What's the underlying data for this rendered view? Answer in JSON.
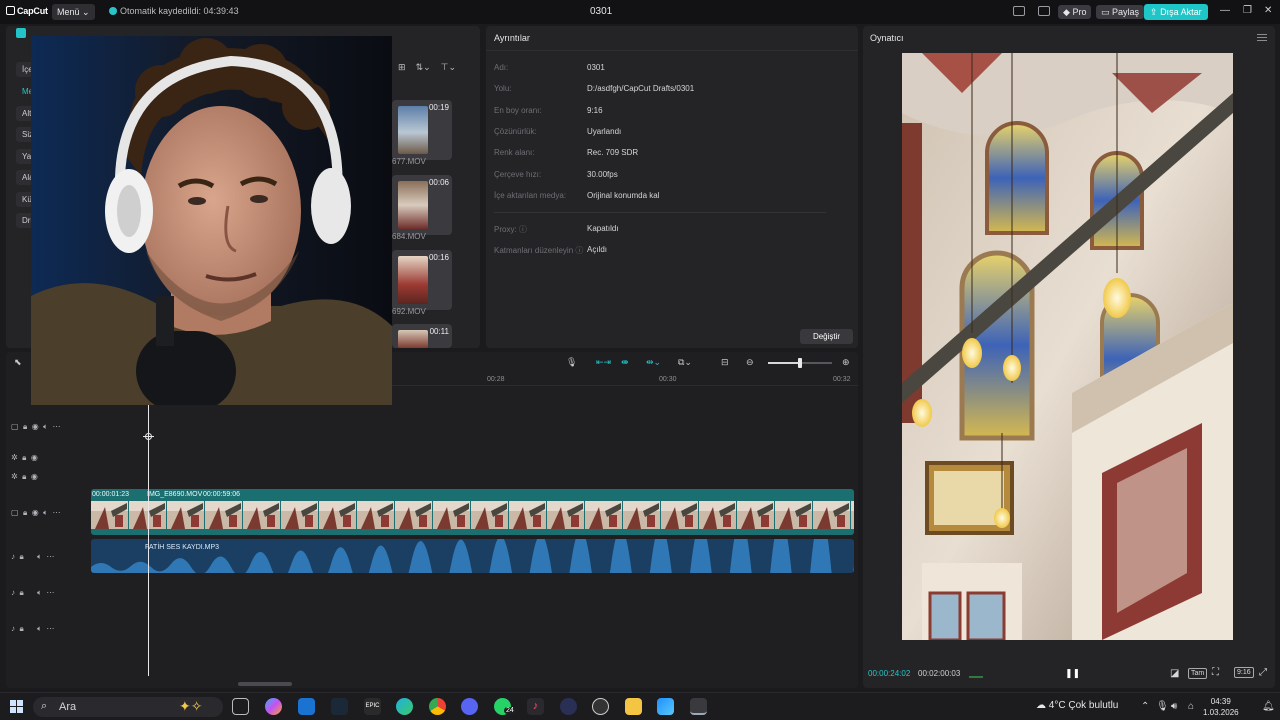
{
  "titlebar": {
    "app_name": "CapCut",
    "menu_label": "Menü",
    "autosave_text": "Otomatik kaydedildi: 04:39:43",
    "project_title": "0301",
    "pro_label": "Pro",
    "share_label": "Paylaş",
    "export_label": "Dışa Aktar"
  },
  "media": {
    "sidebar_items": [
      "İçe",
      "Med",
      "Alt",
      "Sizi",
      "Yap",
      "Alar",
      "Küt",
      "Dre"
    ],
    "thumbnails": [
      {
        "duration": "00:19",
        "name": "677.MOV"
      },
      {
        "duration": "00:06",
        "name": "684.MOV"
      },
      {
        "duration": "00:16",
        "name": "692.MOV"
      },
      {
        "duration": "00:11",
        "name": ""
      }
    ]
  },
  "details": {
    "title": "Ayrıntılar",
    "rows": [
      {
        "label": "Adı:",
        "value": "0301"
      },
      {
        "label": "Yolu:",
        "value": "D:/asdfgh/CapCut Drafts/0301"
      },
      {
        "label": "En boy oranı:",
        "value": "9:16"
      },
      {
        "label": "Çözünürlük:",
        "value": "Uyarlandı"
      },
      {
        "label": "Renk alanı:",
        "value": "Rec. 709 SDR"
      },
      {
        "label": "Çerçeve hızı:",
        "value": "30.00fps"
      },
      {
        "label": "İçe aktarılan medya:",
        "value": "Orijinal konumda kal"
      },
      {
        "label": "Proxy:",
        "value": "Kapatıldı"
      },
      {
        "label": "Katmanları düzenleyin",
        "value": "Açıldı"
      }
    ],
    "change_button": "Değiştir"
  },
  "player": {
    "title": "Oynatıcı",
    "current_time": "00:00:24:02",
    "total_time": "00:02:00:03",
    "ratio_label": "9:16",
    "fit_label": "Tam"
  },
  "timeline": {
    "ruler": [
      "00:28",
      "00:30",
      "00:32"
    ],
    "video_clip": {
      "start_time": "00:00:01:23",
      "name": "IMG_E8690.MOV",
      "duration": "00:00:59:06"
    },
    "audio_clip": {
      "name": "FATİH SES KAYDI.MP3"
    }
  },
  "taskbar": {
    "search_placeholder": "Ara",
    "weather": "4°C  Çok bulutlu",
    "clock_time": "04:39",
    "clock_date": "1.03.2026",
    "whatsapp_badge": "24"
  },
  "colors": {
    "accent": "#1ec6c8",
    "video_clip": "#1c6f70",
    "audio_clip": "#1b3f63",
    "panel": "#242427",
    "background": "#1b1b1d"
  }
}
